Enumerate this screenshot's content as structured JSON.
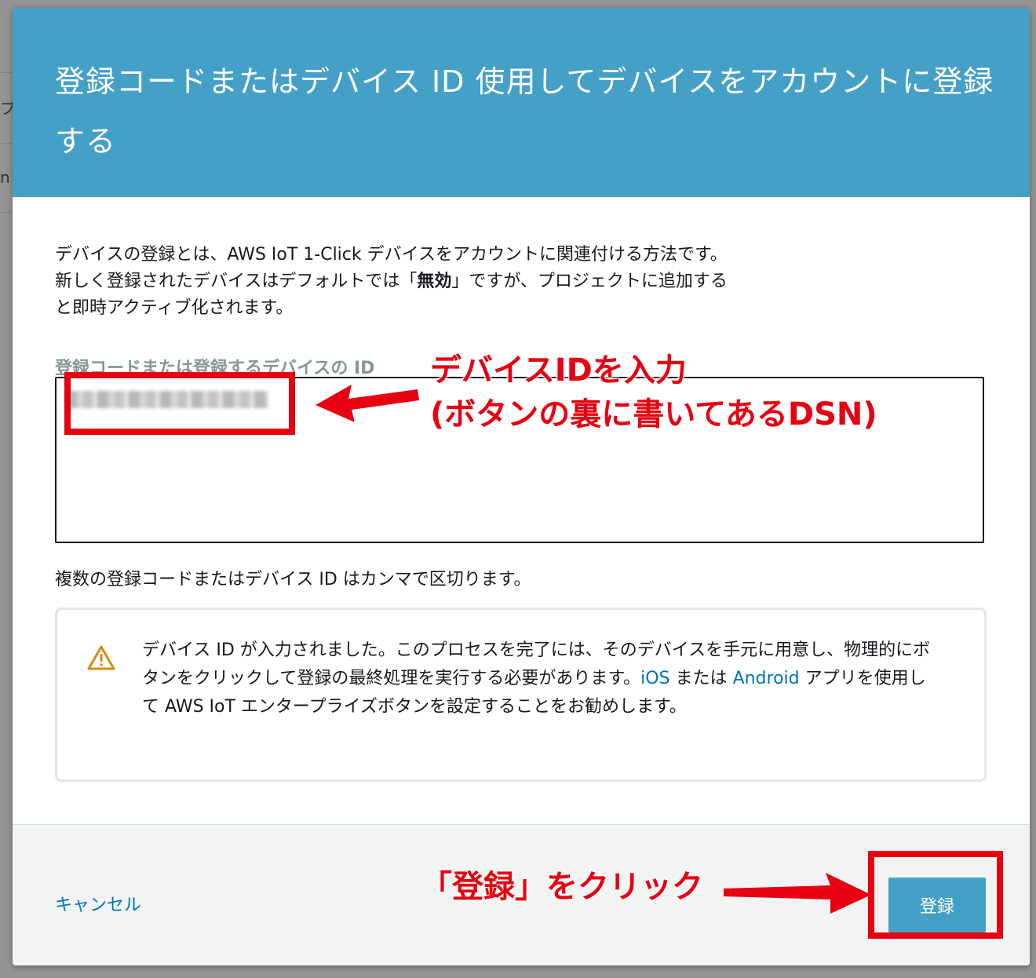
{
  "backdrop": {
    "fragment_1": "プ",
    "fragment_2": "n"
  },
  "modal": {
    "title": "登録コードまたはデバイス ID 使用してデバイスをアカウントに登録する",
    "description_line1": "デバイスの登録とは、AWS IoT 1-Click デバイスをアカウントに関連付ける方法です。",
    "description_line2_pre": "新しく登録されたデバイスはデフォルトでは「",
    "description_line2_bold": "無効",
    "description_line2_post": "」ですが、プロジェクトに追加する",
    "description_line3": "と即時アクティブ化されます。",
    "field_label": "登録コードまたは登録するデバイスの ID",
    "field_value": "",
    "hint": "複数の登録コードまたはデバイス ID はカンマで区切ります。",
    "alert": {
      "icon": "warning-icon",
      "text_part1": "デバイス ID が入力されました。このプロセスを完了には、そのデバイスを手元に用意し、物理的にボタンをクリックして登録の最終処理を実行する必要があります。",
      "link_ios": "iOS",
      "text_part2": " または ",
      "link_android": "Android",
      "text_part3": " アプリを使用して AWS IoT エンタープライズボタンを設定することをお勧めします。"
    },
    "cancel_label": "キャンセル",
    "register_label": "登録"
  },
  "annotations": {
    "input_note_line1": "デバイスIDを入力",
    "input_note_line2": "(ボタンの裏に書いてあるDSN)",
    "button_note": "「登録」をクリック",
    "color": "#e60012"
  },
  "colors": {
    "header": "#44a0c6",
    "button": "#44a0c6",
    "link": "#0073bb",
    "warning": "#d38b10"
  }
}
